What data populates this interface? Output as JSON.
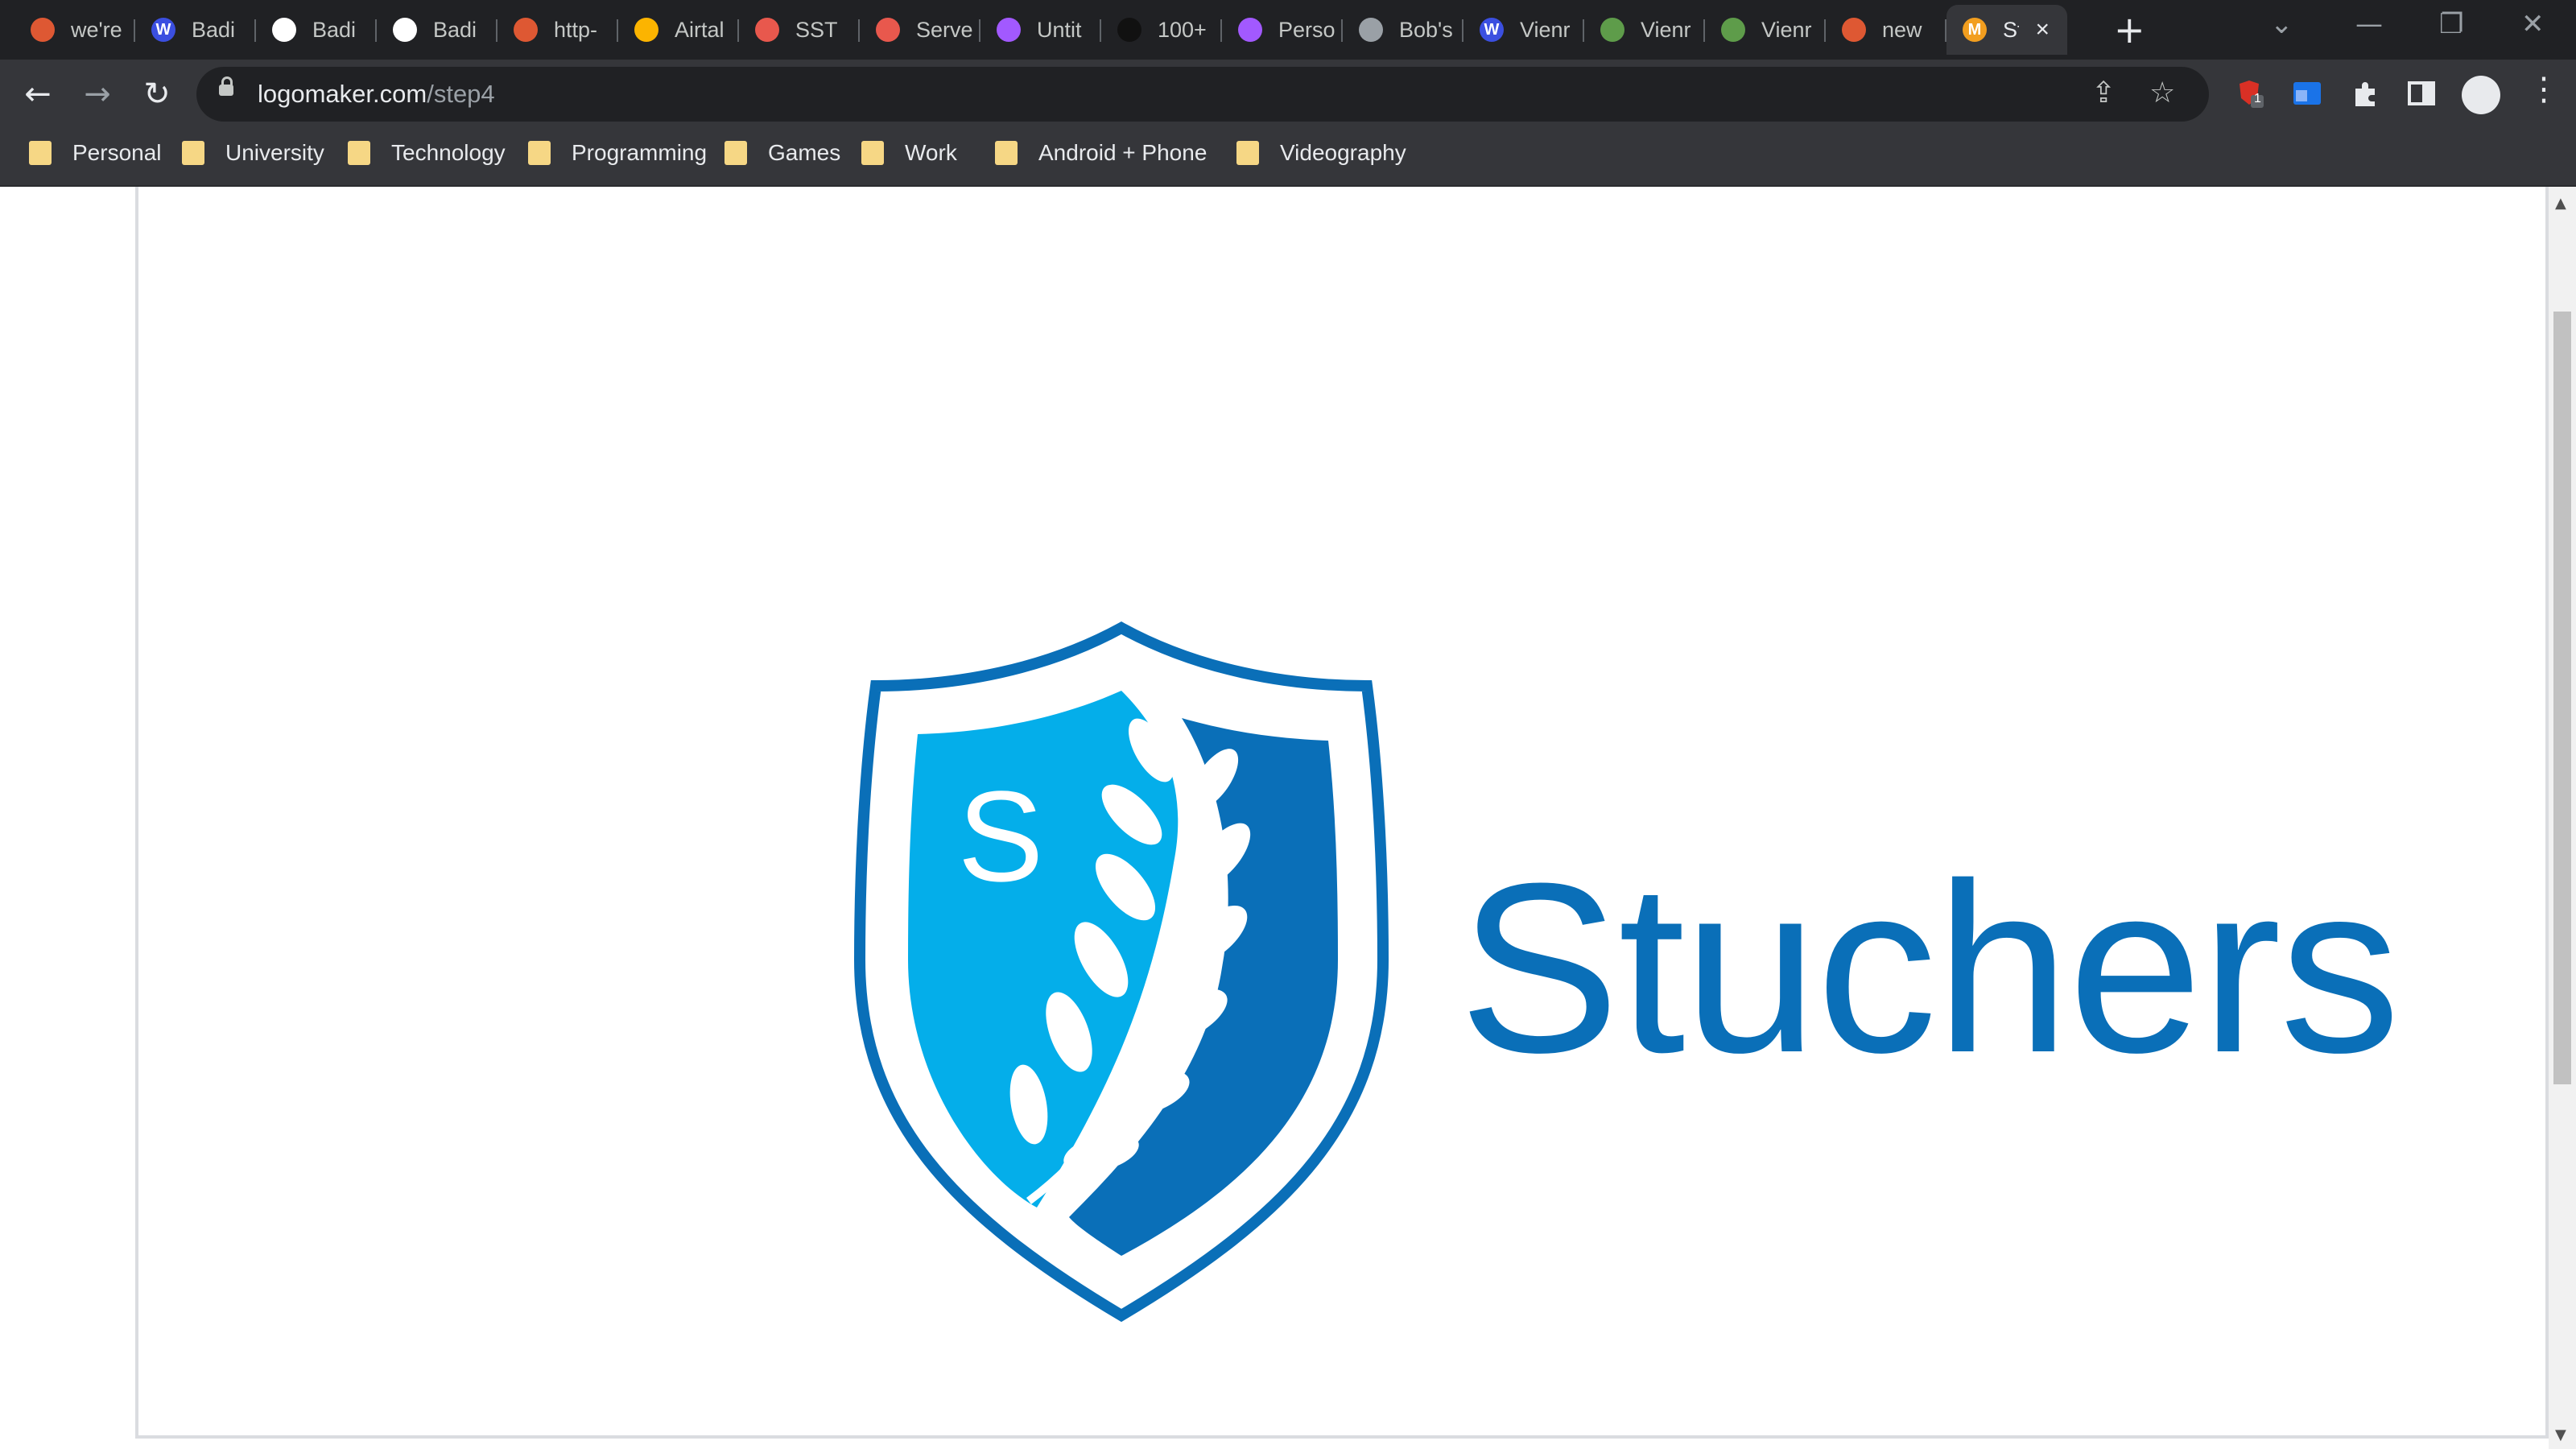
{
  "browser": {
    "tabs": [
      {
        "title": "we're",
        "icon": "duckduckgo-icon",
        "color": "#de5833",
        "glyph": ""
      },
      {
        "title": "Badi",
        "icon": "w-logo-icon",
        "color": "#3b4fe0",
        "glyph": "W"
      },
      {
        "title": "Badi",
        "icon": "photo-portrait-icon",
        "color": "#ffffff",
        "glyph": ""
      },
      {
        "title": "Badi",
        "icon": "photo-portrait-icon",
        "color": "#ffffff",
        "glyph": ""
      },
      {
        "title": "http-",
        "icon": "duckduckgo-icon",
        "color": "#de5833",
        "glyph": ""
      },
      {
        "title": "Airtal",
        "icon": "airtable-icon",
        "color": "#fcb400",
        "glyph": ""
      },
      {
        "title": "SST",
        "icon": "stack-icon",
        "color": "#e8584d",
        "glyph": ""
      },
      {
        "title": "Serve",
        "icon": "list-icon",
        "color": "#e8584d",
        "glyph": ""
      },
      {
        "title": "Untit",
        "icon": "figma-icon",
        "color": "#a259ff",
        "glyph": ""
      },
      {
        "title": "100+",
        "icon": "unsplash-icon",
        "color": "#111111",
        "glyph": ""
      },
      {
        "title": "Perso",
        "icon": "figma-icon",
        "color": "#a259ff",
        "glyph": ""
      },
      {
        "title": "Bob's",
        "icon": "globe-icon",
        "color": "#9aa0a6",
        "glyph": ""
      },
      {
        "title": "Vienr",
        "icon": "w-logo-icon",
        "color": "#3b4fe0",
        "glyph": "W"
      },
      {
        "title": "Vienr",
        "icon": "leaf-icon",
        "color": "#5e9c4a",
        "glyph": ""
      },
      {
        "title": "Vienr",
        "icon": "leaf-icon",
        "color": "#5e9c4a",
        "glyph": ""
      },
      {
        "title": "new",
        "icon": "duckduckgo-icon",
        "color": "#de5833",
        "glyph": ""
      },
      {
        "title": "St",
        "icon": "logomaker-icon",
        "color": "#f29e1f",
        "glyph": "M",
        "active": true
      }
    ],
    "url_host": "logomaker.com",
    "url_path": "/step4",
    "extension_badge": "1",
    "bookmarks": [
      "Personal",
      "University",
      "Technology",
      "Programming",
      "Games",
      "Work",
      "Android + Phone",
      "Videography"
    ]
  },
  "page": {
    "logo": {
      "monogram": "S",
      "brand_name": "Stuchers",
      "colors": {
        "light_blue": "#04aeea",
        "dark_blue": "#0a6fb8",
        "outline": "#0a6fb8"
      }
    }
  }
}
